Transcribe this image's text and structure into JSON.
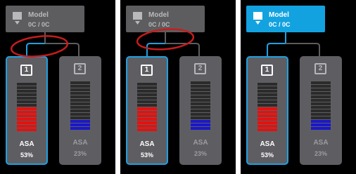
{
  "model": {
    "title": "Model",
    "subtitle": "0C / 0C",
    "icon": "extruder-icon"
  },
  "slots": [
    {
      "number": "1",
      "material": "ASA",
      "percent": "53%",
      "color": "#e4110f",
      "fill_fraction": 0.53
    },
    {
      "number": "2",
      "material": "ASA",
      "percent": "23%",
      "color": "#1a17c7",
      "fill_fraction": 0.23
    }
  ],
  "colors": {
    "accent": "#13a2e0",
    "annotation": "#c81c1c"
  },
  "panels": [
    {
      "state": "slot-1-selected-highlighted"
    },
    {
      "state": "slot-1-selected-highlighted"
    },
    {
      "state": "model-and-slot-1-selected"
    }
  ]
}
